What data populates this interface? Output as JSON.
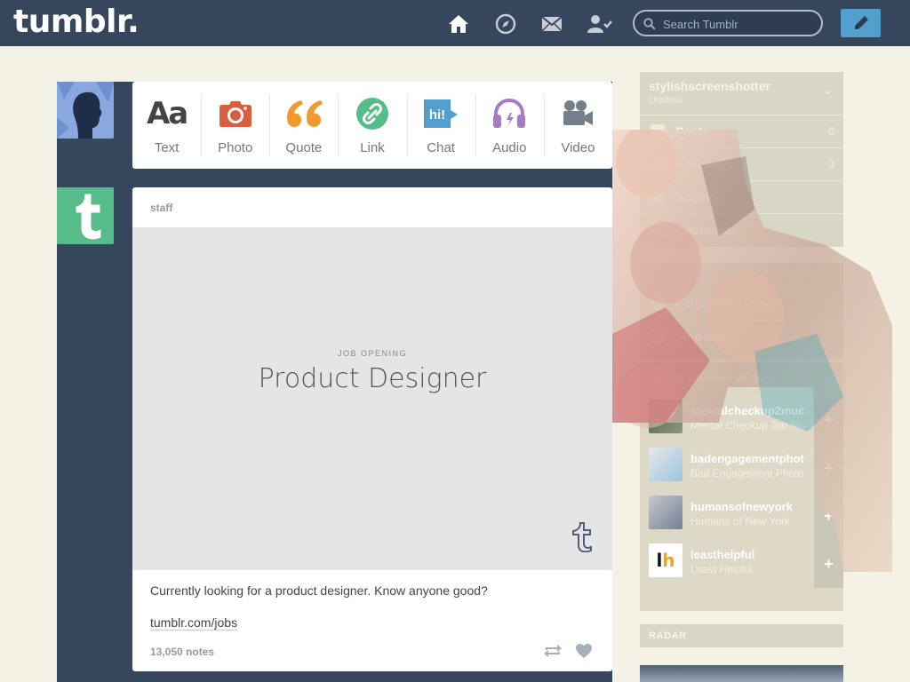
{
  "header": {
    "logo": "tumblr.",
    "search_placeholder": "Search Tumblr",
    "icons": [
      "home-icon",
      "explore-icon",
      "inbox-icon",
      "account-icon"
    ]
  },
  "post_types": [
    {
      "label": "Text",
      "icon": "text-icon",
      "color": "#444444"
    },
    {
      "label": "Photo",
      "icon": "camera-icon",
      "color": "#d95e40"
    },
    {
      "label": "Quote",
      "icon": "quote-icon",
      "color": "#f2992e"
    },
    {
      "label": "Link",
      "icon": "link-icon",
      "color": "#56bc8a"
    },
    {
      "label": "Chat",
      "icon": "chat-icon",
      "color": "#529ecc"
    },
    {
      "label": "Audio",
      "icon": "headphones-icon",
      "color": "#a77dc2"
    },
    {
      "label": "Video",
      "icon": "video-camera-icon",
      "color": "#748089"
    }
  ],
  "post": {
    "user": "staff",
    "eyebrow": "JOB OPENING",
    "title": "Product Designer",
    "caption": "Currently looking for a product designer. Know anyone good?",
    "link": "tumblr.com/jobs",
    "notes": "13,050 notes"
  },
  "sidebar": {
    "blog_name": "stylishscreenshotter",
    "blog_sub": "Untitled",
    "rows": [
      {
        "label": "Posts",
        "count": "0"
      },
      {
        "label": "Followers",
        "count": "3"
      },
      {
        "label": "Activity",
        "count": ""
      },
      {
        "label": "Customize",
        "count": ""
      }
    ],
    "tools": [
      {
        "label": "Following 1 blogs"
      },
      {
        "label": "Find blogs"
      }
    ],
    "recommended_header": "RECOMMENDED BLOGS",
    "recommended": [
      {
        "name": "mentalcheckup2much",
        "desc": "Mental Checkup Too Much"
      },
      {
        "name": "badengagementphotos",
        "desc": "Bad Engagement Photos"
      },
      {
        "name": "humansofnewyork",
        "desc": "Humans of New York"
      },
      {
        "name": "leasthelpful",
        "desc": "Least Helpful"
      }
    ],
    "radar_label": "RADAR"
  },
  "colors": {
    "header_bg": "#36465d",
    "page_bg": "#f4f2e4",
    "compose": "#529ecc",
    "staff_avatar": "#56bc8a"
  }
}
